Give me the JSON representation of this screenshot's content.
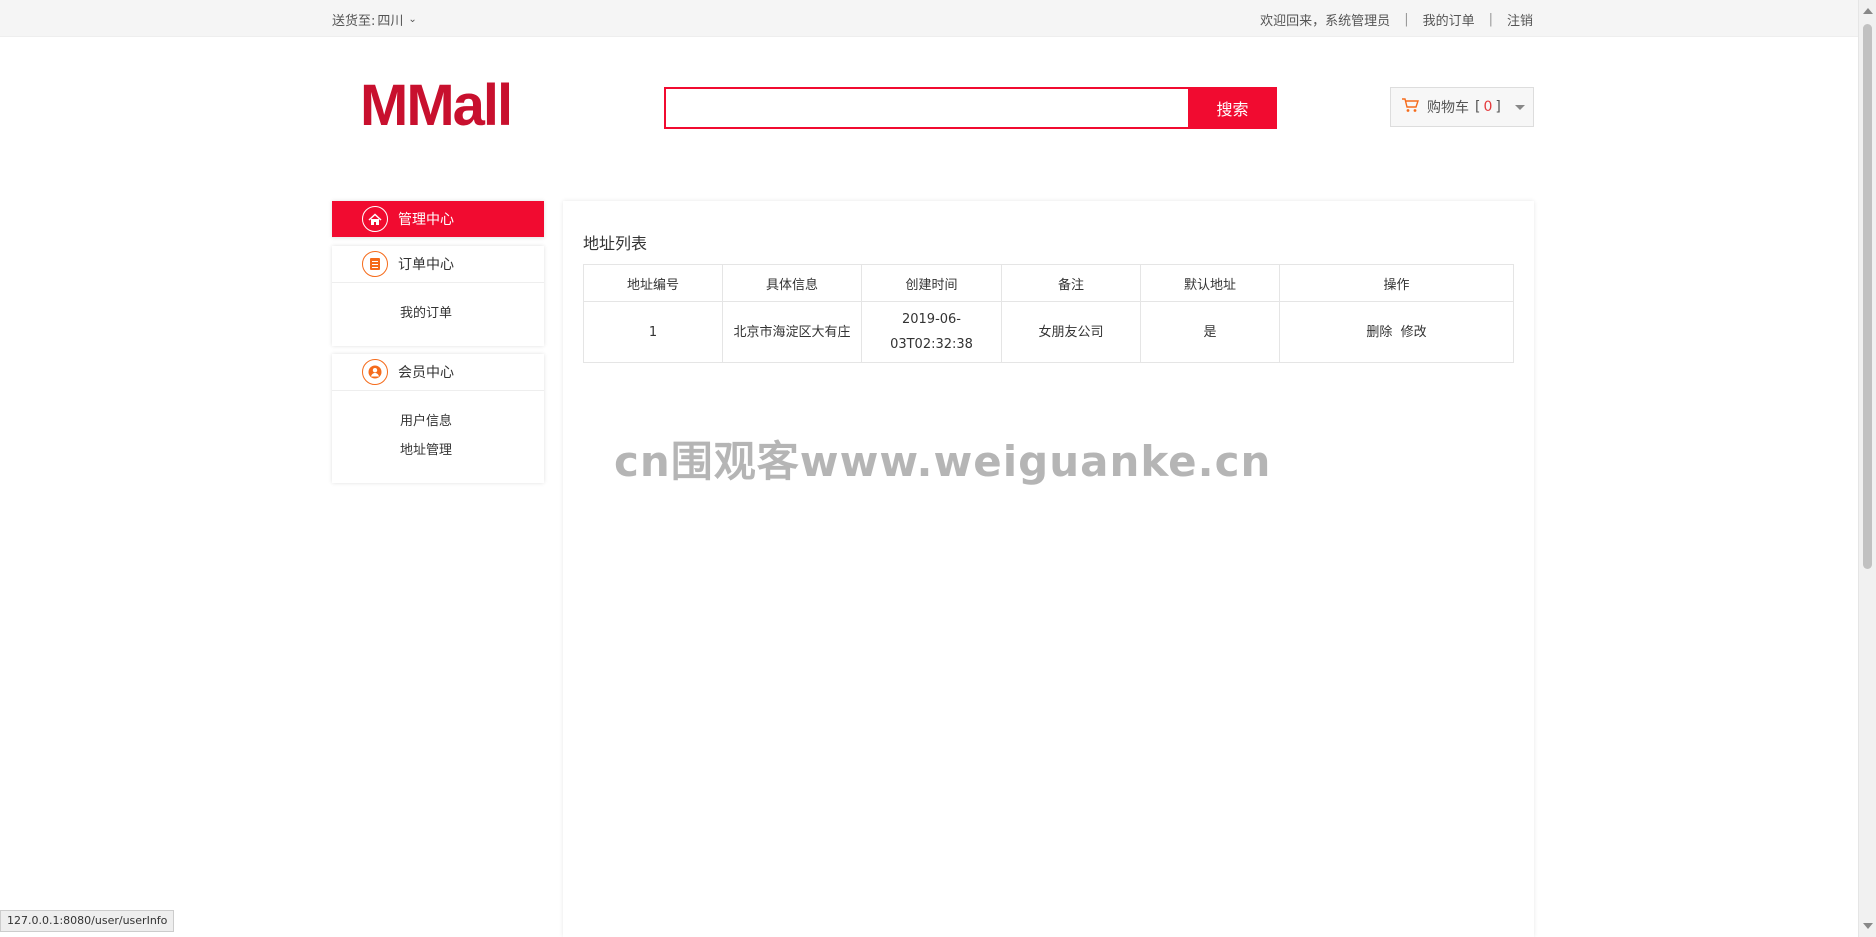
{
  "topbar": {
    "ship_to_label": "送货至:",
    "ship_to_value": "四川",
    "welcome": "欢迎回来，系统管理员",
    "my_orders": "我的订单",
    "logout": "注销",
    "separator": "|"
  },
  "header": {
    "logo": "MMall",
    "search_placeholder": "",
    "search_button": "搜索",
    "cart_label": "购物车",
    "cart_count_open": "[",
    "cart_count": "0",
    "cart_count_close": "]"
  },
  "sidebar": {
    "admin_center": "管理中心",
    "order_center": "订单中心",
    "order_items": [
      "我的订单"
    ],
    "member_center": "会员中心",
    "member_items": [
      "用户信息",
      "地址管理"
    ]
  },
  "main": {
    "title": "地址列表",
    "columns": [
      "地址编号",
      "具体信息",
      "创建时间",
      "备注",
      "默认地址",
      "操作"
    ],
    "rows": [
      {
        "id": "1",
        "detail": "北京市海淀区大有庄",
        "created_line1": "2019-06-",
        "created_line2": "03T02:32:38",
        "remark": "女朋友公司",
        "is_default": "是",
        "delete": "删除",
        "edit": "修改"
      }
    ]
  },
  "watermark": "cn围观客www.weiguanke.cn",
  "statusbar": "127.0.0.1:8080/user/userInfo",
  "colors": {
    "accent": "#f10b30",
    "logo": "#c8102e",
    "icon_orange": "#f56b1b"
  }
}
